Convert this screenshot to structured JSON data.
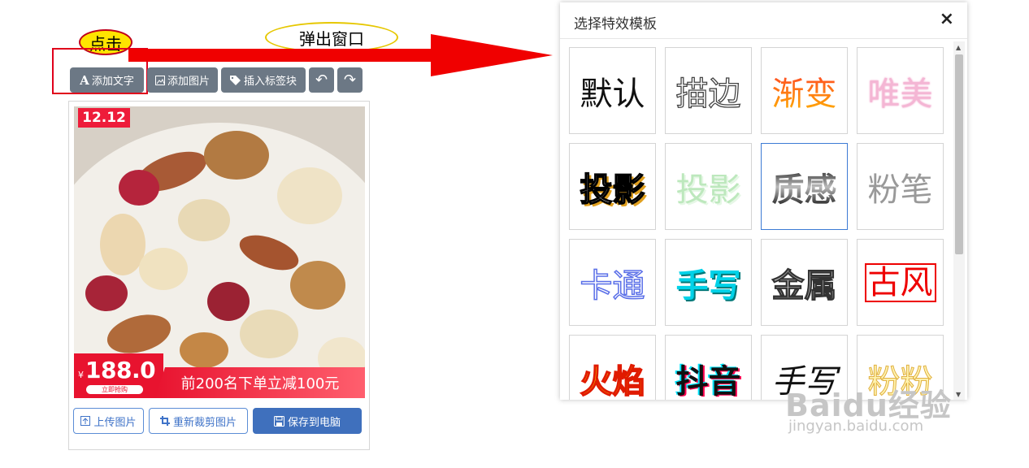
{
  "annotations": {
    "click_label": "点击",
    "popup_label": "弹出窗口"
  },
  "toolbar": {
    "add_text": "添加文字",
    "add_image": "添加图片",
    "insert_tag": "插入标签块",
    "add_text_icon": "A"
  },
  "product": {
    "badge": "12.12",
    "currency": "¥",
    "price": "188.0",
    "price_tag": "立即抢购",
    "promo": "前200名下单立减100元"
  },
  "actions": {
    "upload": "上传图片",
    "recrop": "重新裁剪图片",
    "save": "保存到电脑"
  },
  "dialog": {
    "title": "选择特效模板",
    "close": "×",
    "templates": [
      {
        "label": "默认",
        "style": "default"
      },
      {
        "label": "描边",
        "style": "outline"
      },
      {
        "label": "渐变",
        "style": "gradient"
      },
      {
        "label": "唯美",
        "style": "beauty"
      },
      {
        "label": "投影",
        "style": "shadow1"
      },
      {
        "label": "投影",
        "style": "shadow2"
      },
      {
        "label": "质感",
        "style": "texture",
        "selected": true
      },
      {
        "label": "粉笔",
        "style": "chalk"
      },
      {
        "label": "卡通",
        "style": "cartoon"
      },
      {
        "label": "手写",
        "style": "hand"
      },
      {
        "label": "金属",
        "style": "metal"
      },
      {
        "label": "古风",
        "style": "ancient"
      },
      {
        "label": "火焰",
        "style": "fire"
      },
      {
        "label": "抖音",
        "style": "douyin"
      },
      {
        "label": "手写",
        "style": "hand2"
      },
      {
        "label": "粉粉",
        "style": "pink"
      }
    ]
  },
  "watermark": {
    "brand": "Baidu经验",
    "url": "jingyan.baidu.com"
  },
  "colors": {
    "accent_red": "#e0001b",
    "toolbar_gray": "#6c7885",
    "primary_blue": "#3f70bd",
    "price_red": "#e8132f"
  }
}
